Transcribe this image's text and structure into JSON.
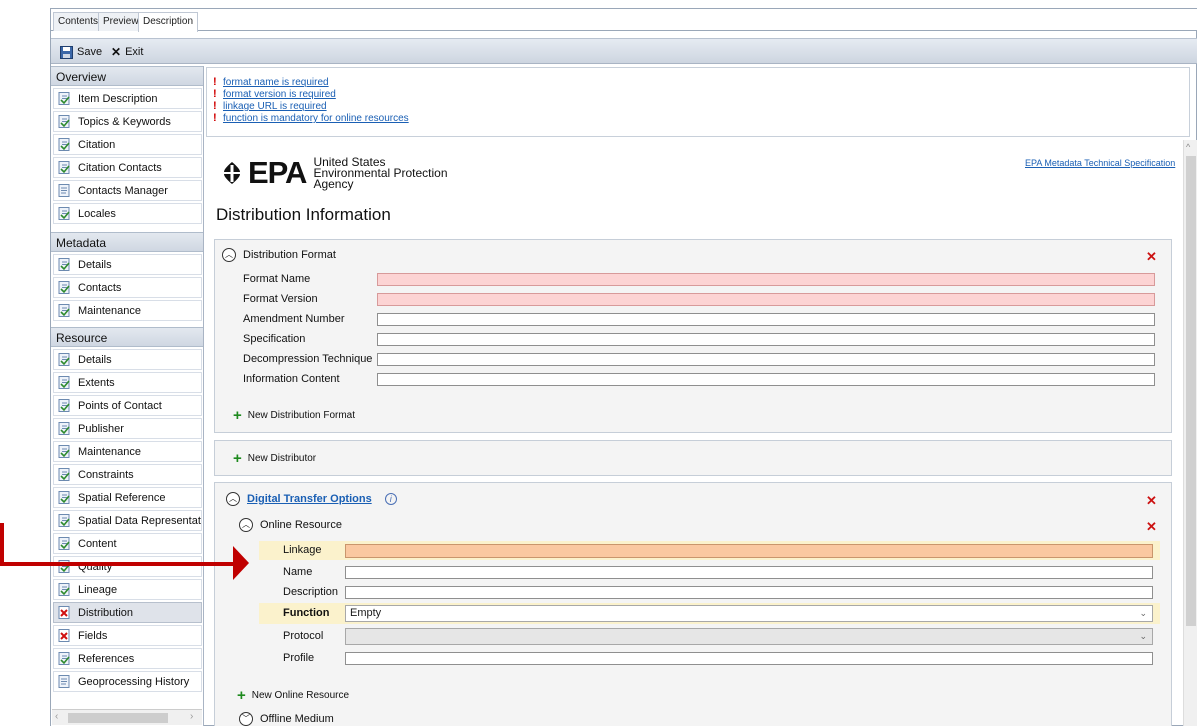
{
  "tabs": [
    "Contents",
    "Preview",
    "Description"
  ],
  "toolbar": {
    "save": "Save",
    "exit": "Exit"
  },
  "nav": {
    "overview_header": "Overview",
    "overview": [
      "Item Description",
      "Topics & Keywords",
      "Citation",
      "Citation Contacts",
      "Contacts Manager",
      "Locales"
    ],
    "metadata_header": "Metadata",
    "metadata": [
      "Details",
      "Contacts",
      "Maintenance"
    ],
    "resource_header": "Resource",
    "resource": [
      "Details",
      "Extents",
      "Points of Contact",
      "Publisher",
      "Maintenance",
      "Constraints",
      "Spatial Reference",
      "Spatial Data Representation",
      "Content",
      "Quality",
      "Lineage",
      "Distribution",
      "Fields",
      "References",
      "Geoprocessing History"
    ],
    "selected": "Distribution"
  },
  "errors": [
    "format name is required",
    "format version is required",
    "linkage URL is required",
    "function is mandatory for online resources"
  ],
  "logo": {
    "mark": "EPA",
    "line1": "United States",
    "line2": "Environmental Protection",
    "line3": "Agency"
  },
  "spec_link": "EPA Metadata Technical Specification",
  "page_title": "Distribution Information",
  "distribution_format": {
    "title": "Distribution Format",
    "fields": [
      "Format Name",
      "Format Version",
      "Amendment Number",
      "Specification",
      "Decompression Technique",
      "Information Content"
    ],
    "add": "New Distribution Format"
  },
  "distributor": {
    "add": "New Distributor"
  },
  "transfer": {
    "title": "Digital Transfer Options",
    "online_title": "Online Resource",
    "fields": {
      "linkage": "Linkage",
      "name": "Name",
      "description": "Description",
      "function": "Function",
      "protocol": "Protocol",
      "profile": "Profile"
    },
    "function_value": "Empty",
    "add_online": "New Online Resource",
    "offline_title": "Offline Medium"
  },
  "colors": {
    "error_fill": "#fcd3d3",
    "warning_fill": "#fac8a0",
    "highlight": "#fbf2cc",
    "arrow": "#c00000"
  }
}
